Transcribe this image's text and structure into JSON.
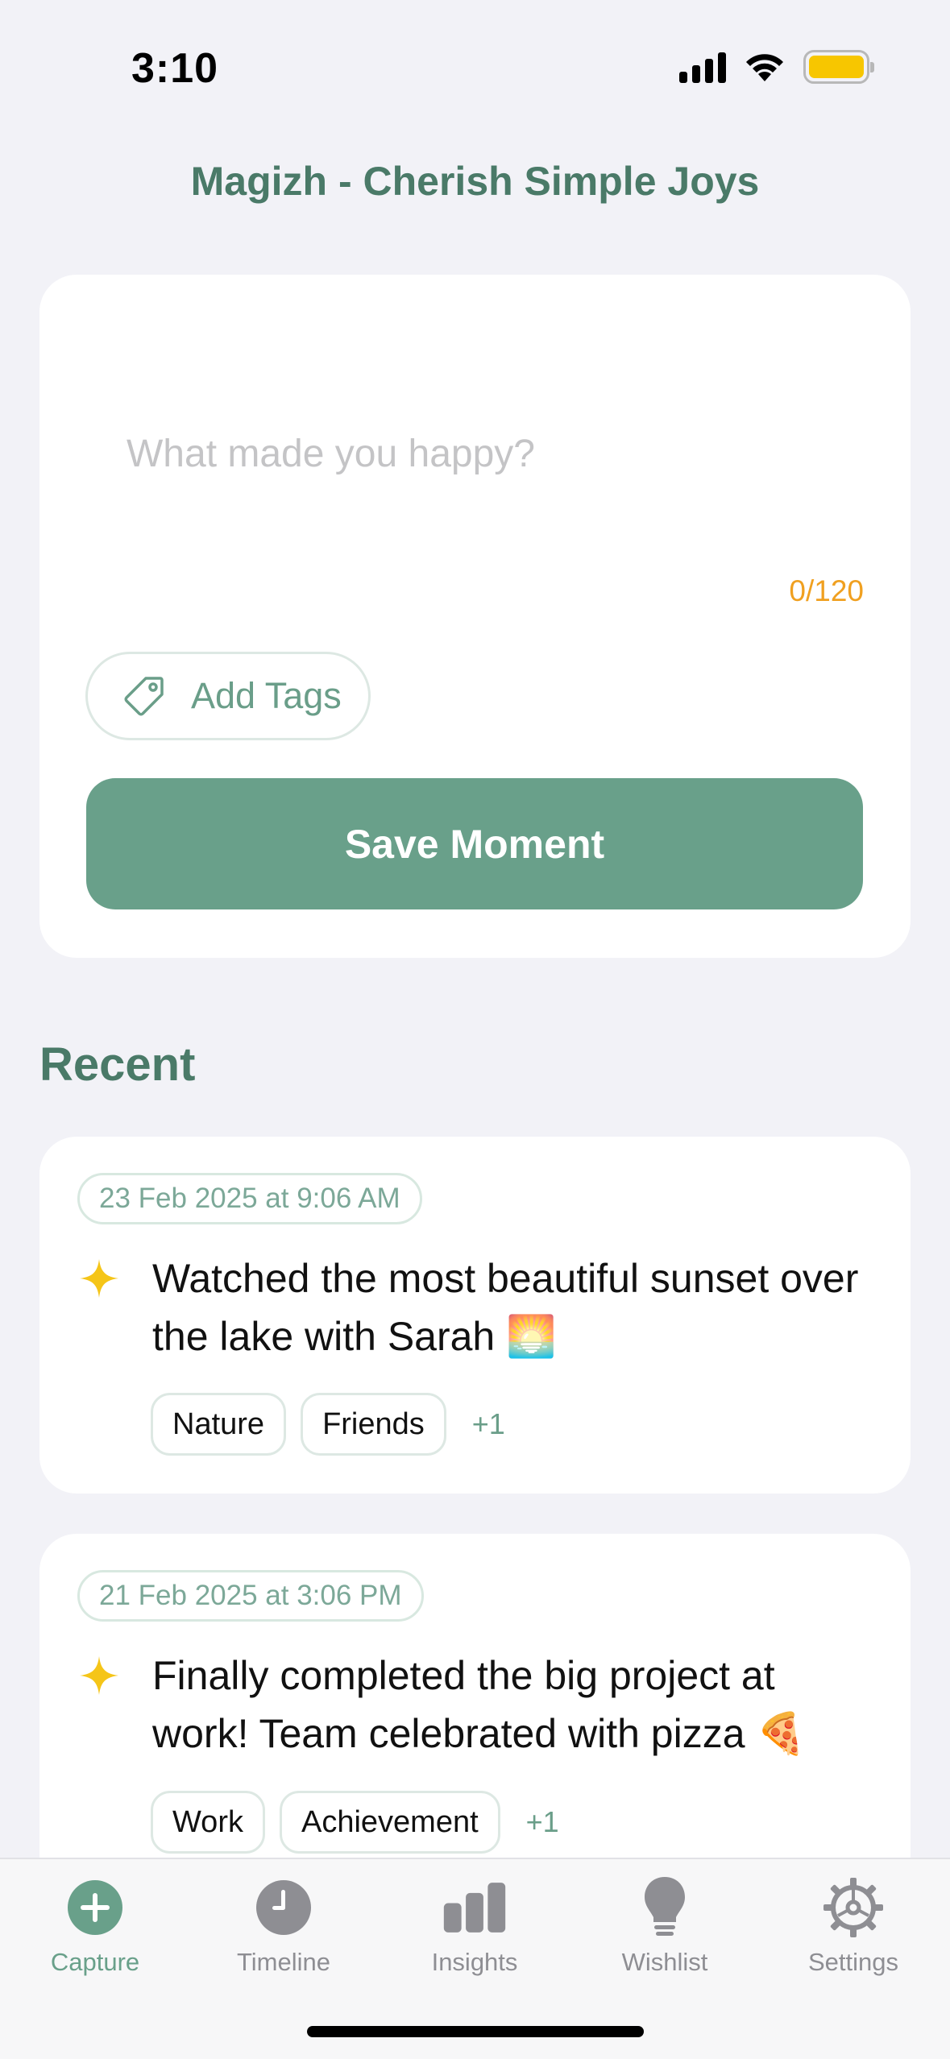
{
  "status_bar": {
    "time": "3:10"
  },
  "app": {
    "title": "Magizh - Cherish Simple Joys"
  },
  "capture": {
    "placeholder": "What made you happy?",
    "char_count": "0/120",
    "add_tags_label": "Add Tags",
    "save_label": "Save Moment"
  },
  "recent": {
    "heading": "Recent",
    "moments": [
      {
        "date": "23 Feb 2025 at 9:06 AM",
        "text": "Watched the most beautiful sunset over the lake with Sarah 🌅",
        "tags": [
          "Nature",
          "Friends"
        ],
        "more": "+1"
      },
      {
        "date": "21 Feb 2025 at 3:06 PM",
        "text": "Finally completed the big project at work! Team celebrated with pizza 🍕",
        "tags": [
          "Work",
          "Achievement"
        ],
        "more": "+1"
      }
    ]
  },
  "tabs": [
    {
      "label": "Capture",
      "icon": "plus-circle-icon",
      "active": true
    },
    {
      "label": "Timeline",
      "icon": "clock-icon",
      "active": false
    },
    {
      "label": "Insights",
      "icon": "bar-chart-icon",
      "active": false
    },
    {
      "label": "Wishlist",
      "icon": "lightbulb-icon",
      "active": false
    },
    {
      "label": "Settings",
      "icon": "gear-icon",
      "active": false
    }
  ],
  "colors": {
    "accent": "#69a08a",
    "title": "#4a7a68",
    "counter": "#f0a020",
    "sparkle": "#f5c518",
    "background": "#f2f2f7"
  }
}
